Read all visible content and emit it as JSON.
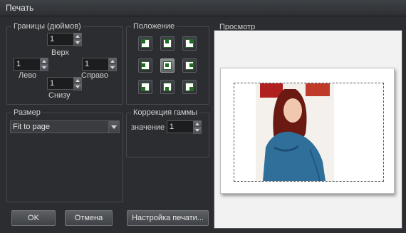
{
  "window": {
    "title": "Печать"
  },
  "margins": {
    "title": "Границы (дюймов)",
    "top": {
      "label": "Верх",
      "value": "1"
    },
    "left": {
      "label": "Лево",
      "value": "1"
    },
    "right": {
      "label": "Справо",
      "value": "1"
    },
    "bottom": {
      "label": "Снизу",
      "value": "1"
    }
  },
  "position": {
    "title": "Положение",
    "selected": "center"
  },
  "size": {
    "title": "Размер",
    "selected": "Fit to page"
  },
  "gamma": {
    "title": "Коррекция гаммы",
    "label": "значение",
    "value": "1"
  },
  "preview": {
    "title": "Просмотр"
  },
  "buttons": {
    "ok": "OK",
    "cancel": "Отмена",
    "setup": "Настройка печати..."
  },
  "colors": {
    "accent_green": "#1d6e1d",
    "background": "#2b2d30"
  }
}
